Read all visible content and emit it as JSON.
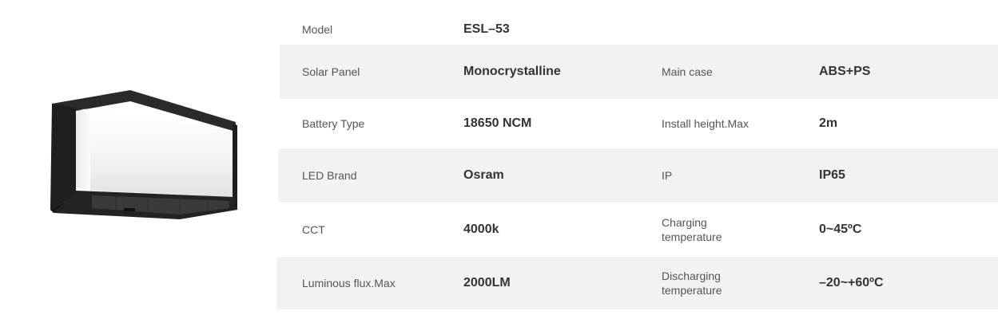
{
  "specs": {
    "model_label": "Model",
    "model_value": "ESL–53",
    "rows": [
      {
        "label_left": "Solar Panel",
        "value_left": "Monocrystalline",
        "label_right": "Main case",
        "value_right": "ABS+PS"
      },
      {
        "label_left": "Battery Type",
        "value_left": "18650 NCM",
        "label_right": "Install height.Max",
        "value_right": "2m"
      },
      {
        "label_left": "LED Brand",
        "value_left": "Osram",
        "label_right": "IP",
        "value_right": "IP65"
      },
      {
        "label_left": "CCT",
        "value_left": "4000k",
        "label_right": "Charging temperature",
        "value_right": "0~45ºC"
      },
      {
        "label_left": "Luminous flux.Max",
        "value_left": "2000LM",
        "label_right": "Discharging temperature",
        "value_right": "–20~+60ºC"
      }
    ]
  },
  "colors": {
    "row_shade": "#f2f2f2",
    "frame": "#1e1e1e",
    "diffuser": "#f7f7f7"
  }
}
